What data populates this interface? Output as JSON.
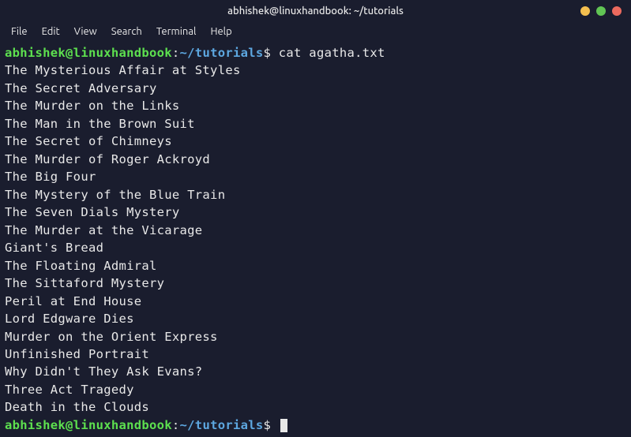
{
  "window": {
    "title": "abhishek@linuxhandbook: ~/tutorials"
  },
  "menubar": {
    "items": [
      "File",
      "Edit",
      "View",
      "Search",
      "Terminal",
      "Help"
    ]
  },
  "prompt": {
    "user_host": "abhishek@linuxhandbook",
    "separator": ":",
    "path": "~/tutorials",
    "symbol": "$"
  },
  "command1": "cat agatha.txt",
  "output": [
    "The Mysterious Affair at Styles",
    "The Secret Adversary",
    "The Murder on the Links",
    "The Man in the Brown Suit",
    "The Secret of Chimneys",
    "The Murder of Roger Ackroyd",
    "The Big Four",
    "The Mystery of the Blue Train",
    "The Seven Dials Mystery",
    "The Murder at the Vicarage",
    "Giant's Bread",
    "The Floating Admiral",
    "The Sittaford Mystery",
    "Peril at End House",
    "Lord Edgware Dies",
    "Murder on the Orient Express",
    "Unfinished Portrait",
    "Why Didn't They Ask Evans?",
    "Three Act Tragedy",
    "Death in the Clouds"
  ],
  "command2": ""
}
